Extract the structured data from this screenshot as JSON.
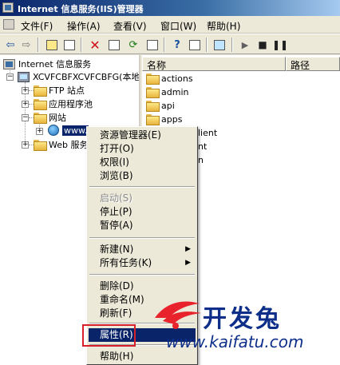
{
  "window": {
    "title": "Internet 信息服务(IIS)管理器"
  },
  "menubar": [
    {
      "label": "文件(F)"
    },
    {
      "label": "操作(A)"
    },
    {
      "label": "查看(V)"
    },
    {
      "label": "窗口(W)"
    },
    {
      "label": "帮助(H)"
    }
  ],
  "toolbar": {
    "buttons": [
      "back-arrow-icon",
      "forward-arrow-icon",
      "up-folder-icon",
      "show-hide-tree-icon",
      "delete-x-icon",
      "properties-icon",
      "refresh-icon",
      "export-icon",
      "help-icon",
      "console-icon",
      "computer-icon",
      "play-icon",
      "stop-icon",
      "pause-icon"
    ]
  },
  "tree": {
    "root": "Internet 信息服务",
    "server": "XCVFCBFXCVFCBFG(本地计算机)",
    "ftp": "FTP 站点",
    "apppools": "应用程序池",
    "websites": "网站",
    "site": "www.",
    "webext": "Web 服务扩展"
  },
  "list": {
    "col_name": "名称",
    "col_path": "路径",
    "items": [
      "actions",
      "admin",
      "api",
      "apps"
    ],
    "partial_items": [
      "lient",
      "nt",
      "n"
    ]
  },
  "context_menu": {
    "items": [
      {
        "label": "资源管理器(E)"
      },
      {
        "label": "打开(O)"
      },
      {
        "label": "权限(I)"
      },
      {
        "label": "浏览(B)"
      },
      {
        "label": "启动(S)"
      },
      {
        "label": "停止(P)"
      },
      {
        "label": "暂停(A)"
      },
      {
        "label": "新建(N)"
      },
      {
        "label": "所有任务(K)"
      },
      {
        "label": "删除(D)"
      },
      {
        "label": "重命名(M)"
      },
      {
        "label": "刷新(F)"
      },
      {
        "label": "属性(R)"
      },
      {
        "label": "帮助(H)"
      }
    ]
  },
  "watermark": {
    "brand": "开发兔",
    "url": "www.kaifatu.com"
  },
  "colors": {
    "selection": "#0a246a",
    "highlight_box": "#d8202a",
    "face": "#ece9d8"
  }
}
